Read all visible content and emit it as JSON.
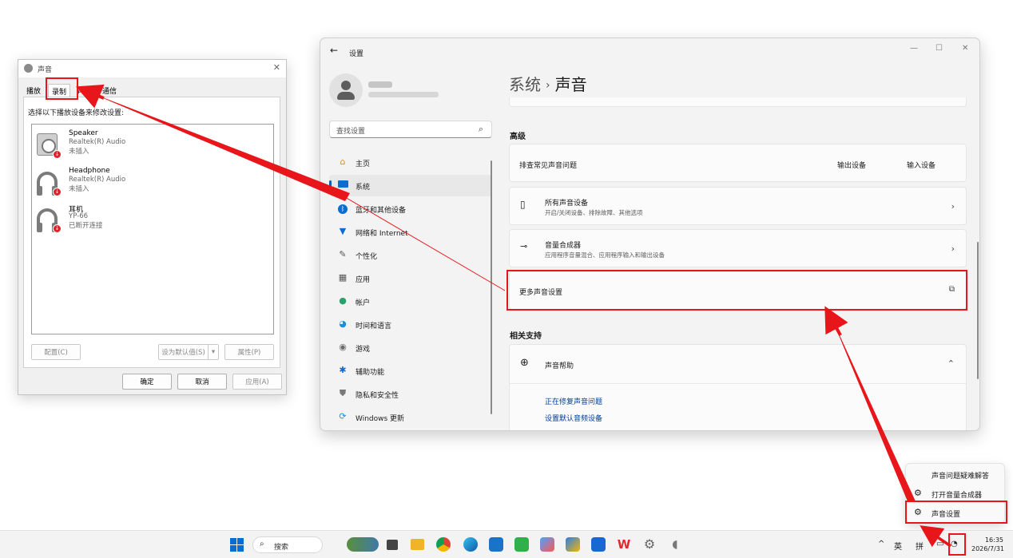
{
  "sound_dialog": {
    "title": "声音",
    "close": "✕",
    "tabs": [
      "播放",
      "录制",
      "声音",
      "通信"
    ],
    "hint": "选择以下播放设备来修改设置:",
    "devices": [
      {
        "name": "Speaker",
        "driver": "Realtek(R) Audio",
        "status": "未插入"
      },
      {
        "name": "Headphone",
        "driver": "Realtek(R) Audio",
        "status": "未插入"
      },
      {
        "name": "耳机",
        "driver": "YP-66",
        "status": "已断开连接"
      }
    ],
    "configure_button": "配置(C)",
    "set_default_button": "设为默认值(S)",
    "properties_button": "属性(P)",
    "ok_button": "确定",
    "cancel_button": "取消",
    "apply_button": "应用(A)"
  },
  "settings": {
    "window_title": "设置",
    "back": "←",
    "min": "—",
    "max": "☐",
    "close": "✕",
    "search_placeholder": "查找设置",
    "nav": [
      {
        "label": "主页",
        "icon": "home-icon"
      },
      {
        "label": "系统",
        "icon": "system-icon"
      },
      {
        "label": "蓝牙和其他设备",
        "icon": "bluetooth-icon"
      },
      {
        "label": "网络和 Internet",
        "icon": "network-icon"
      },
      {
        "label": "个性化",
        "icon": "personalize-icon"
      },
      {
        "label": "应用",
        "icon": "apps-icon"
      },
      {
        "label": "帐户",
        "icon": "account-icon"
      },
      {
        "label": "时间和语言",
        "icon": "time-language-icon"
      },
      {
        "label": "游戏",
        "icon": "gaming-icon"
      },
      {
        "label": "辅助功能",
        "icon": "accessibility-icon"
      },
      {
        "label": "隐私和安全性",
        "icon": "privacy-icon"
      },
      {
        "label": "Windows 更新",
        "icon": "windows-update-icon"
      }
    ],
    "breadcrumb_parent": "系统",
    "breadcrumb_sep": "›",
    "breadcrumb_current": "声音",
    "advanced_header": "高级",
    "troubleshoot_label": "排查常见声音问题",
    "output_devices": "输出设备",
    "input_devices": "输入设备",
    "all_devices_title": "所有声音设备",
    "all_devices_sub": "开启/关闭设备、排除故障、其他选项",
    "mixer_title": "音量合成器",
    "mixer_sub": "应用程序音量混合、应用程序输入和输出设备",
    "more_sound_settings": "更多声音设置",
    "related_header": "相关支持",
    "sound_help": "声音帮助",
    "help_links": [
      "正在修复声音问题",
      "设置默认音频设备"
    ]
  },
  "popup_menu": {
    "items": [
      "声音问题疑难解答",
      "打开音量合成器",
      "声音设置"
    ]
  },
  "taskbar": {
    "search_placeholder": "搜索",
    "tray_chevron": "^",
    "ime_lang": "英",
    "ime_mode": "拼",
    "time": "16:35",
    "date": "2026/7/31"
  },
  "colors": {
    "accent": "#005fb8",
    "annotation_red": "#e8151b"
  }
}
